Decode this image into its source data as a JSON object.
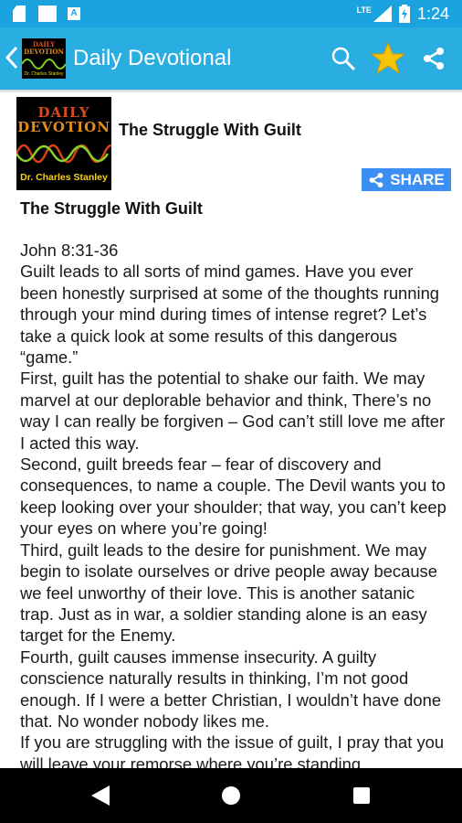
{
  "status_bar": {
    "network": "LTE",
    "time": "1:24",
    "icons": [
      "sd-card-icon",
      "blank-notification-icon",
      "a-notification-icon",
      "signal-icon",
      "battery-charging-icon"
    ]
  },
  "app_bar": {
    "title": "Daily Devotional",
    "logo": {
      "line1": "DAILY",
      "line2": "DEVOTION",
      "byline": "Dr. Charles Stanley"
    },
    "actions": [
      "search-icon",
      "favorite-star-icon",
      "share-icon"
    ],
    "star_color": "#f6c20a"
  },
  "devotional": {
    "header_title": "The Struggle With Guilt",
    "thumbnail": {
      "line1": "DAILY",
      "line2": "DEVOTION",
      "byline": "Dr. Charles Stanley"
    },
    "share_label": "SHARE",
    "title": "The Struggle With Guilt",
    "paragraphs": [
      "John 8:31-36",
      "Guilt leads to all sorts of mind games. Have you ever been honestly surprised at some of the thoughts running through your mind during times of intense regret? Let’s take a quick look at some results of this dangerous “game.”",
      "First, guilt has the potential to shake our faith. We may marvel at our deplorable behavior and think, There’s no way I can really be forgiven – God can’t still love me after I acted this way.",
      "Second, guilt breeds fear – fear of discovery and consequences, to name a couple. The Devil wants you to keep looking over your shoulder; that way, you can’t keep your eyes on where you’re going!",
      "Third, guilt leads to the desire for punishment. We may begin to isolate ourselves or drive people away because we feel unworthy of their love. This is another satanic trap. Just as in war, a soldier standing alone is an easy target for the Enemy.",
      "Fourth, guilt causes immense insecurity. A guilty conscience naturally results in thinking, I’m not good enough. If I were a better Christian, I wouldn’t have done that. No wonder nobody likes me.",
      "If you are struggling with the issue of guilt, I pray that you will leave your remorse where you’re standing"
    ]
  },
  "colors": {
    "status_bar": "#1aa3de",
    "app_bar": "#2aaee2",
    "share_button": "#3b8ff3",
    "nav_bar": "#000000"
  },
  "nav_bar": {
    "buttons": [
      "back-triangle-icon",
      "home-circle-icon",
      "recents-square-icon"
    ]
  }
}
